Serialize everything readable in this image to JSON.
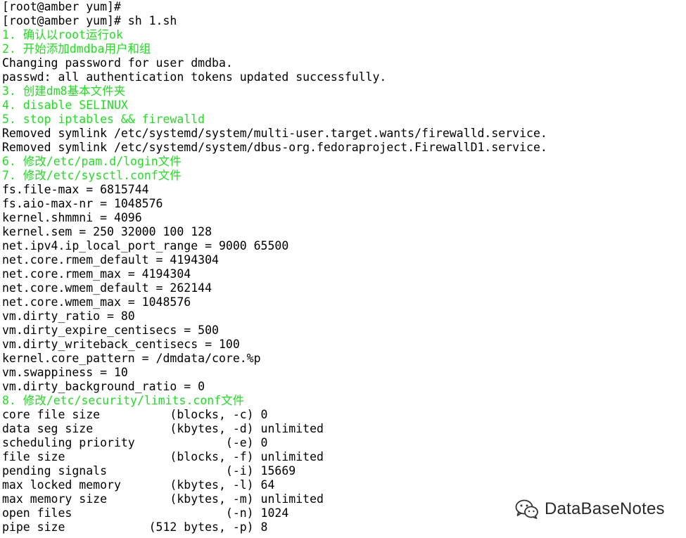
{
  "terminal": {
    "lines": [
      {
        "text": "[root@amber yum]#",
        "color": "#000000"
      },
      {
        "text": "[root@amber yum]# sh 1.sh",
        "color": "#000000"
      },
      {
        "text": "1. 确认以root运行ok",
        "color": "#22dd22"
      },
      {
        "text": "2. 开始添加dmdba用户和组",
        "color": "#22dd22"
      },
      {
        "text": "Changing password for user dmdba.",
        "color": "#000000"
      },
      {
        "text": "passwd: all authentication tokens updated successfully.",
        "color": "#000000"
      },
      {
        "text": "3. 创建dm8基本文件夹",
        "color": "#22dd22"
      },
      {
        "text": "4. disable SELINUX",
        "color": "#22dd22"
      },
      {
        "text": "5. stop iptables && firewalld",
        "color": "#22dd22"
      },
      {
        "text": "Removed symlink /etc/systemd/system/multi-user.target.wants/firewalld.service.",
        "color": "#000000"
      },
      {
        "text": "Removed symlink /etc/systemd/system/dbus-org.fedoraproject.FirewallD1.service.",
        "color": "#000000"
      },
      {
        "text": "6. 修改/etc/pam.d/login文件",
        "color": "#22dd22"
      },
      {
        "text": "7. 修改/etc/sysctl.conf文件",
        "color": "#22dd22"
      },
      {
        "text": "fs.file-max = 6815744",
        "color": "#000000"
      },
      {
        "text": "fs.aio-max-nr = 1048576",
        "color": "#000000"
      },
      {
        "text": "kernel.shmmni = 4096",
        "color": "#000000"
      },
      {
        "text": "kernel.sem = 250 32000 100 128",
        "color": "#000000"
      },
      {
        "text": "net.ipv4.ip_local_port_range = 9000 65500",
        "color": "#000000"
      },
      {
        "text": "net.core.rmem_default = 4194304",
        "color": "#000000"
      },
      {
        "text": "net.core.rmem_max = 4194304",
        "color": "#000000"
      },
      {
        "text": "net.core.wmem_default = 262144",
        "color": "#000000"
      },
      {
        "text": "net.core.wmem_max = 1048576",
        "color": "#000000"
      },
      {
        "text": "vm.dirty_ratio = 80",
        "color": "#000000"
      },
      {
        "text": "vm.dirty_expire_centisecs = 500",
        "color": "#000000"
      },
      {
        "text": "vm.dirty_writeback_centisecs = 100",
        "color": "#000000"
      },
      {
        "text": "kernel.core_pattern = /dmdata/core.%p",
        "color": "#000000"
      },
      {
        "text": "vm.swappiness = 10",
        "color": "#000000"
      },
      {
        "text": "vm.dirty_background_ratio = 0",
        "color": "#000000"
      },
      {
        "text": "8. 修改/etc/security/limits.conf文件",
        "color": "#22dd22"
      },
      {
        "text": "core file size          (blocks, -c) 0",
        "color": "#000000"
      },
      {
        "text": "data seg size           (kbytes, -d) unlimited",
        "color": "#000000"
      },
      {
        "text": "scheduling priority             (-e) 0",
        "color": "#000000"
      },
      {
        "text": "file size               (blocks, -f) unlimited",
        "color": "#000000"
      },
      {
        "text": "pending signals                 (-i) 15669",
        "color": "#000000"
      },
      {
        "text": "max locked memory       (kbytes, -l) 64",
        "color": "#000000"
      },
      {
        "text": "max memory size         (kbytes, -m) unlimited",
        "color": "#000000"
      },
      {
        "text": "open files                      (-n) 1024",
        "color": "#000000"
      },
      {
        "text": "pipe size            (512 bytes, -p) 8",
        "color": "#000000"
      }
    ]
  },
  "watermark": {
    "text": "DataBaseNotes",
    "icon": "wechat-icon"
  }
}
